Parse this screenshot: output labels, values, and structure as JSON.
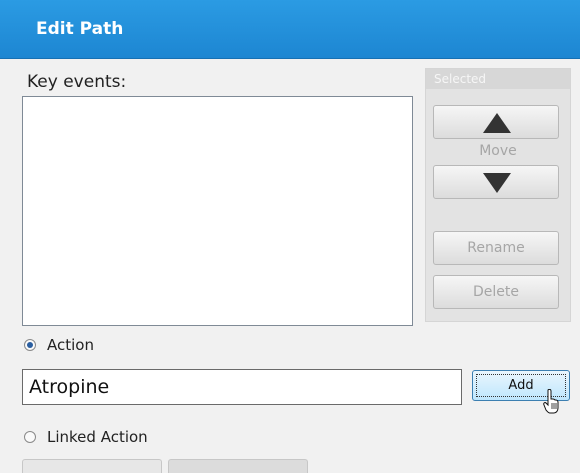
{
  "window": {
    "title": "Edit Path"
  },
  "key_events": {
    "label": "Key events:",
    "items": []
  },
  "selected_panel": {
    "header": "Selected",
    "move_label": "Move",
    "rename_label": "Rename",
    "delete_label": "Delete"
  },
  "action": {
    "radio_label": "Action",
    "selected": true,
    "input_value": "Atropine",
    "add_label": "Add"
  },
  "linked_action": {
    "radio_label": "Linked Action",
    "selected": false
  },
  "colors": {
    "title_bar": "#2192dc",
    "radio_dot": "#2a5ea0",
    "add_button_border": "#3c7fb1"
  }
}
